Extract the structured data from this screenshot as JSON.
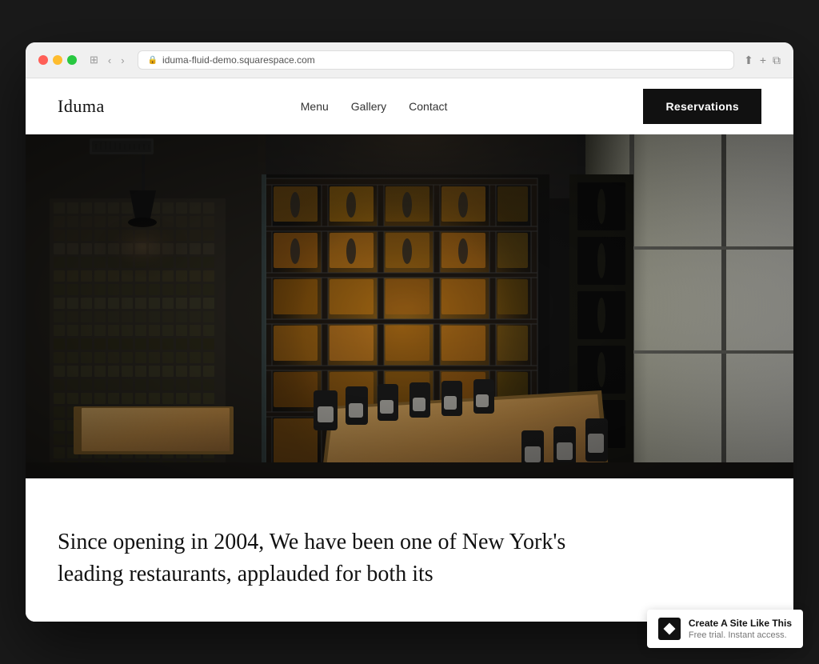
{
  "browser": {
    "url": "iduma-fluid-demo.squarespace.com",
    "controls": {
      "back": "‹",
      "forward": "›"
    }
  },
  "nav": {
    "logo": "Iduma",
    "links": [
      {
        "label": "Menu",
        "id": "menu"
      },
      {
        "label": "Gallery",
        "id": "gallery"
      },
      {
        "label": "Contact",
        "id": "contact"
      }
    ],
    "cta": "Reservations"
  },
  "hero": {
    "alt": "Restaurant interior with wine racks and dining tables"
  },
  "content": {
    "text": "Since opening in 2004, We have been one of New York's leading restaurants, applauded for both its"
  },
  "badge": {
    "main": "Create A Site Like This",
    "sub": "Free trial. Instant access."
  }
}
